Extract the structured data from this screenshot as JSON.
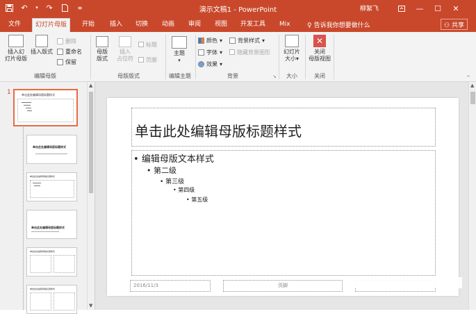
{
  "window": {
    "title": "演示文稿1  -  PowerPoint",
    "user": "柳絮飞",
    "controls": [
      "ribbon-display",
      "minimize",
      "maximize",
      "close"
    ]
  },
  "qat": {
    "save_icon": "save-icon",
    "undo_icon": "undo-icon",
    "redo_icon": "redo-icon",
    "new_icon": "new-doc-icon",
    "customize_icon": "customize-icon"
  },
  "tabs": {
    "file": "文件",
    "slide_master": "幻灯片母版",
    "home": "开始",
    "insert": "插入",
    "transitions": "切换",
    "animations": "动画",
    "review": "审阅",
    "view": "视图",
    "developer": "开发工具",
    "mix": "Mix",
    "tell_me": "告诉我你想要做什么",
    "share": "共享"
  },
  "ribbon": {
    "insert_slide_master_1": "插入幻",
    "insert_slide_master_2": "灯片母版",
    "insert_layout": "插入版式",
    "delete": "删除",
    "rename": "重命名",
    "preserve": "保留",
    "group_edit_master": "编辑母版",
    "master_layout_1": "母版",
    "master_layout_2": "版式",
    "insert_placeholder_1": "插入",
    "insert_placeholder_2": "占位符",
    "title_check": "标题",
    "footer_check": "页脚",
    "group_master_layout": "母版版式",
    "themes_1": "主题",
    "group_edit_theme": "编辑主题",
    "colors": "颜色",
    "fonts": "字体",
    "effects": "效果",
    "background_styles": "背景样式",
    "hide_background": "隐藏背景图形",
    "group_background": "背景",
    "slide_size_1": "幻灯片",
    "slide_size_2": "大小",
    "group_size": "大小",
    "close_master_1": "关闭",
    "close_master_2": "母版视图",
    "group_close": "关闭"
  },
  "thumbnails": {
    "master_number": "1",
    "master_title": "单击此处编辑母版标题样式",
    "layout_title": "单击此处编辑母版标题样式"
  },
  "slide": {
    "title": "单击此处编辑母版标题样式",
    "level1": "编辑母版文本样式",
    "level2": "第二级",
    "level3": "第三级",
    "level4": "第四级",
    "level5": "第五级",
    "date": "2016/11/3",
    "footer": "页脚"
  },
  "colors": {
    "accent": "#c9482b",
    "selected_thumb_border": "#e46c42"
  }
}
